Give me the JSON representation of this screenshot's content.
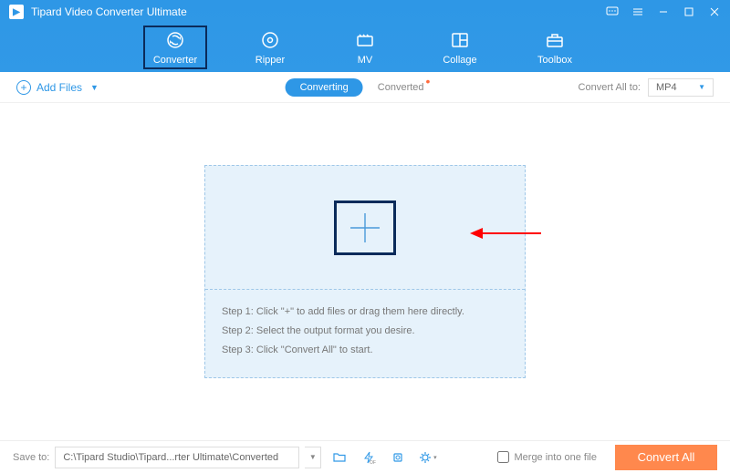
{
  "app": {
    "title": "Tipard Video Converter Ultimate"
  },
  "nav": [
    {
      "label": "Converter"
    },
    {
      "label": "Ripper"
    },
    {
      "label": "MV"
    },
    {
      "label": "Collage"
    },
    {
      "label": "Toolbox"
    }
  ],
  "toolbar": {
    "add_files": "Add Files",
    "tab_converting": "Converting",
    "tab_converted": "Converted",
    "convert_all_to": "Convert All to:",
    "format": "MP4"
  },
  "steps": {
    "s1": "Step 1: Click \"+\" to add files or drag them here directly.",
    "s2": "Step 2: Select the output format you desire.",
    "s3": "Step 3: Click \"Convert All\" to start."
  },
  "footer": {
    "save_to": "Save to:",
    "path": "C:\\Tipard Studio\\Tipard...rter Ultimate\\Converted",
    "merge": "Merge into one file",
    "convert_all": "Convert All"
  }
}
